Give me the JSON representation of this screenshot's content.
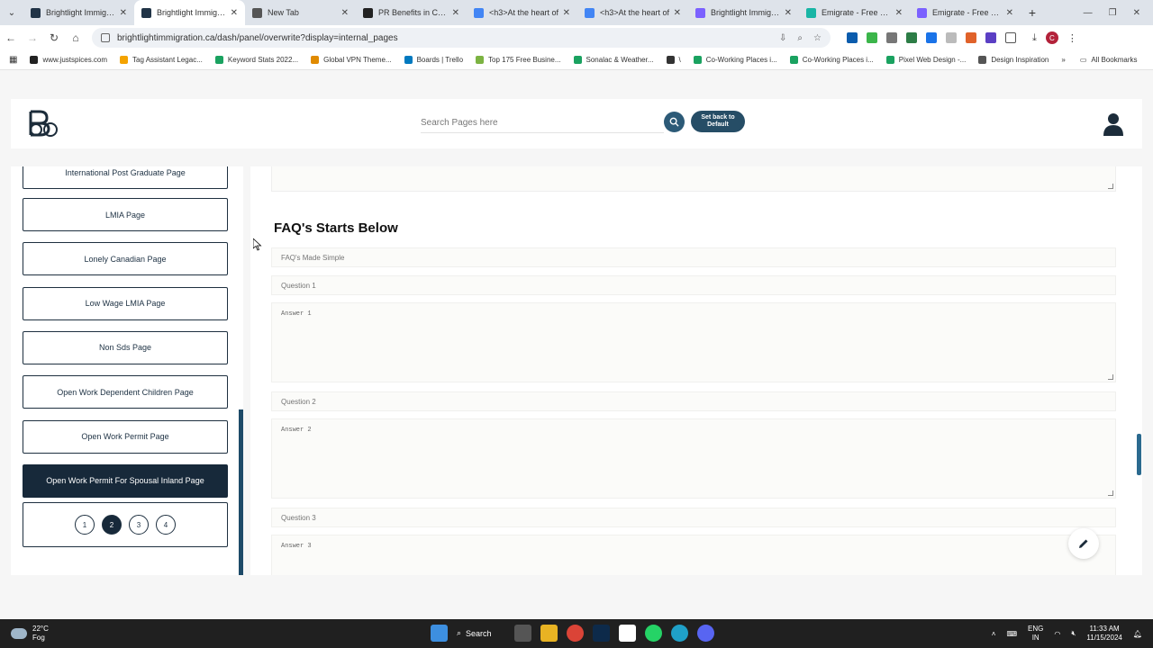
{
  "browser": {
    "tabs": [
      {
        "label": "Brightlight Immigration",
        "color": "#213447",
        "active": false
      },
      {
        "label": "Brightlight Immigration",
        "color": "#213447",
        "active": true
      },
      {
        "label": "New Tab",
        "color": "#555555",
        "active": false
      },
      {
        "label": "PR Benefits in Canada",
        "color": "#222222",
        "active": false
      },
      {
        "label": "<h3>At the heart of",
        "color": "#4285f4",
        "active": false
      },
      {
        "label": "<h3>At the heart of",
        "color": "#4285f4",
        "active": false
      },
      {
        "label": "Brightlight Immigration",
        "color": "#7b61ff",
        "active": false
      },
      {
        "label": "Emigrate - Free arrow",
        "color": "#19b5a5",
        "active": false
      },
      {
        "label": "Emigrate - Free arrow",
        "color": "#7b61ff",
        "active": false
      }
    ],
    "url": "brightlightimmigration.ca/dash/panel/overwrite?display=internal_pages",
    "bookmarks": [
      {
        "label": "www.justspices.com",
        "color": "#222222"
      },
      {
        "label": "Tag Assistant Legac...",
        "color": "#f4a300"
      },
      {
        "label": "Keyword Stats 2022...",
        "color": "#1aa260"
      },
      {
        "label": "Global VPN Theme...",
        "color": "#e08a00"
      },
      {
        "label": "Boards | Trello",
        "color": "#0079bf"
      },
      {
        "label": "Top 175 Free Busine...",
        "color": "#7cb342"
      },
      {
        "label": "Sonalac & Weather...",
        "color": "#1aa260"
      },
      {
        "label": "\\",
        "color": "#333333"
      },
      {
        "label": "Co-Working Places i...",
        "color": "#1aa260"
      },
      {
        "label": "Co-Working Places i...",
        "color": "#1aa260"
      },
      {
        "label": "Pixel Web Design -...",
        "color": "#1aa260"
      },
      {
        "label": "Design Inspiration",
        "color": "#555555"
      }
    ],
    "more_bookmarks": "»",
    "all_bookmarks": "All Bookmarks",
    "profile_initial": "C"
  },
  "header": {
    "search_placeholder": "Search Pages here",
    "reset_label": "Set back to Default"
  },
  "sidebar": {
    "partial_item": "International Post Graduate Page",
    "items": [
      {
        "label": "LMIA Page",
        "active": false
      },
      {
        "label": "Lonely Canadian Page",
        "active": false
      },
      {
        "label": "Low Wage LMIA Page",
        "active": false
      },
      {
        "label": "Non Sds Page",
        "active": false
      },
      {
        "label": "Open Work Dependent Children Page",
        "active": false
      },
      {
        "label": "Open Work Permit Page",
        "active": false
      },
      {
        "label": "Open Work Permit For Spousal Inland Page",
        "active": true
      }
    ],
    "pages": [
      "1",
      "2",
      "3",
      "4"
    ],
    "current_page": "2"
  },
  "main": {
    "faq_heading": "FAQ's Starts Below",
    "faq_title_placeholder": "FAQ's Made Simple",
    "q1_placeholder": "Question 1",
    "a1_placeholder": "Answer 1",
    "q2_placeholder": "Question 2",
    "a2_placeholder": "Answer 2",
    "q3_placeholder": "Question 3",
    "a3_placeholder": "Answer 3"
  },
  "taskbar": {
    "temperature": "22°C",
    "weather": "Fog",
    "search_label": "Search",
    "language": "ENG",
    "region": "IN",
    "time": "11:33 AM",
    "date": "11/15/2024"
  }
}
